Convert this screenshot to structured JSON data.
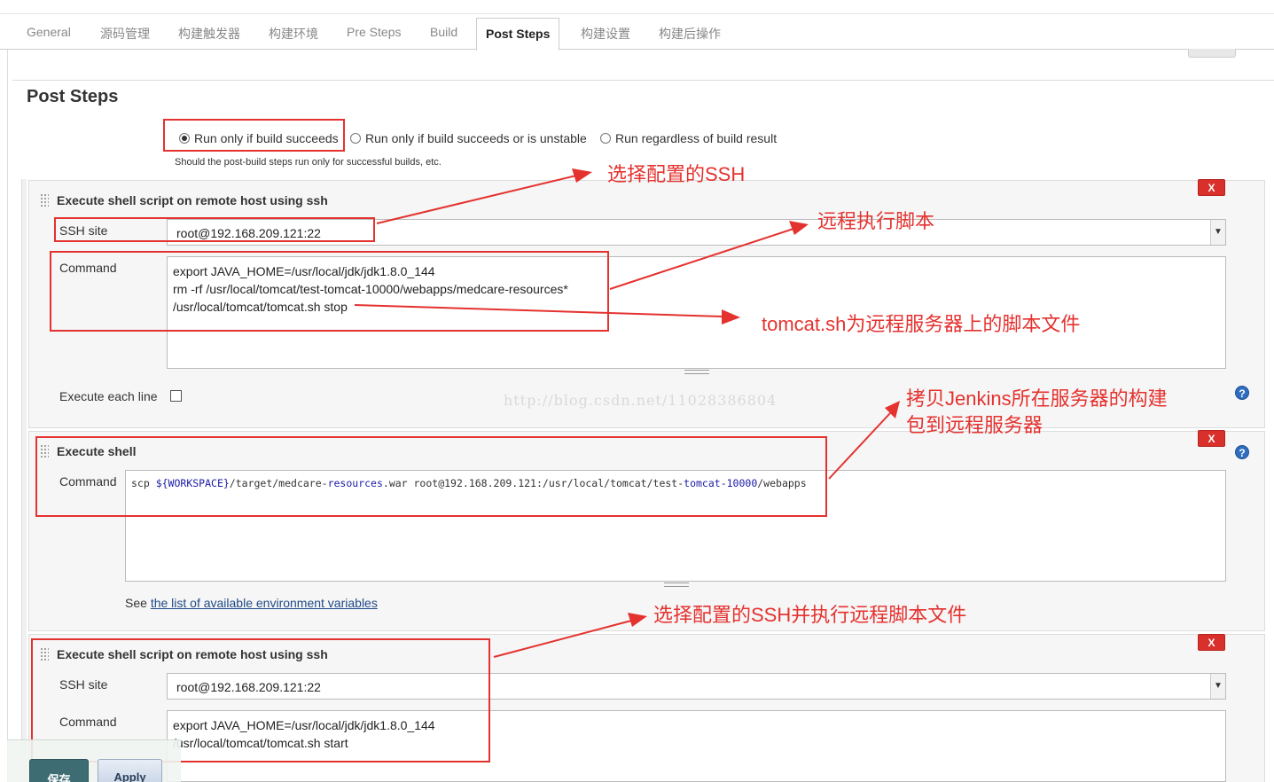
{
  "tabs": [
    "General",
    "源码管理",
    "构建触发器",
    "构建环境",
    "Pre Steps",
    "Build",
    "Post Steps",
    "构建设置",
    "构建后操作"
  ],
  "active_tab": "Post Steps",
  "section_title": "Post Steps",
  "radio_options": {
    "succeeds": "Run only if build succeeds",
    "unstable": "Run only if build succeeds or is unstable",
    "regardless": "Run regardless of build result"
  },
  "radio_selected": "Run only if build succeeds",
  "radio_hint": "Should the post-build steps run only for successful builds, etc.",
  "block1": {
    "title": "Execute shell script on remote host using ssh",
    "delete_label": "X",
    "ssh_site_label": "SSH site",
    "ssh_site_value": "root@192.168.209.121:22",
    "command_label": "Command",
    "command_value": "export JAVA_HOME=/usr/local/jdk/jdk1.8.0_144\nrm -rf /usr/local/tomcat/test-tomcat-10000/webapps/medcare-resources*\n/usr/local/tomcat/tomcat.sh stop",
    "execute_each_line_label": "Execute each line",
    "help_icon": "?"
  },
  "block2": {
    "title": "Execute shell",
    "delete_label": "X",
    "command_label": "Command",
    "command_parts": {
      "p1": "scp ",
      "var": "${WORKSPACE}",
      "p2": "/target/medcare-",
      "p3": "resources",
      "p4": ".war root@192.168.209.121:/usr/local/tomcat/test-",
      "p5": "tomcat-10000",
      "p6": "/webapps"
    },
    "see_prefix": "See ",
    "see_link": "the list of available environment variables",
    "help_icon": "?"
  },
  "block3": {
    "title": "Execute shell script on remote host using ssh",
    "delete_label": "X",
    "ssh_site_label": "SSH site",
    "ssh_site_value": "root@192.168.209.121:22",
    "command_label": "Command",
    "command_value": "export JAVA_HOME=/usr/local/jdk/jdk1.8.0_144\n/usr/local/tomcat/tomcat.sh start"
  },
  "watermark": "http://blog.csdn.net/11028386804",
  "annotations": {
    "a1": "选择配置的SSH",
    "a2": "远程执行脚本",
    "a3": "tomcat.sh为远程服务器上的脚本文件",
    "a4_line1": "拷贝Jenkins所在服务器的构建",
    "a4_line2": "包到远程服务器",
    "a5": "选择配置的SSH并执行远程脚本文件"
  },
  "buttons": {
    "save": "保存",
    "apply": "Apply"
  },
  "colors": {
    "annotation_red": "#e4322f",
    "delete_red": "#d9302c",
    "save_button": "#3d6c72"
  }
}
